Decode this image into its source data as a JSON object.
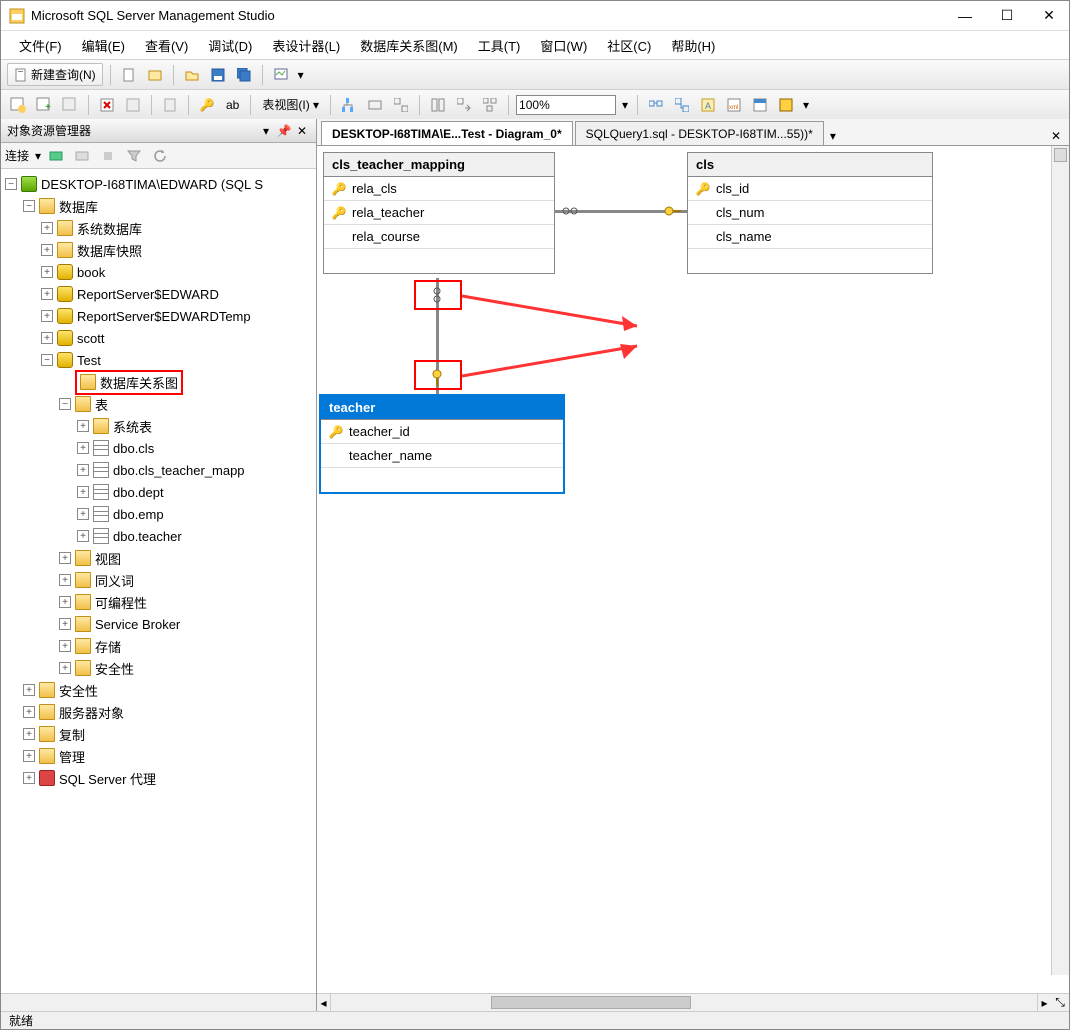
{
  "app": {
    "title": "Microsoft SQL Server Management Studio"
  },
  "menu": {
    "file": "文件(F)",
    "edit": "编辑(E)",
    "view": "查看(V)",
    "debug": "调试(D)",
    "tableDesigner": "表设计器(L)",
    "dbDiagram": "数据库关系图(M)",
    "tools": "工具(T)",
    "window": "窗口(W)",
    "community": "社区(C)",
    "help": "帮助(H)"
  },
  "toolbar1": {
    "newQuery": "新建查询(N)"
  },
  "toolbar2": {
    "ab": "ab",
    "tableView": "表视图(I)",
    "zoom": "100%"
  },
  "objectExplorer": {
    "title": "对象资源管理器",
    "connect": "连接",
    "serverLabel": "DESKTOP-I68TIMA\\EDWARD (SQL S",
    "databases": "数据库",
    "systemDatabases": "系统数据库",
    "dbSnapshots": "数据库快照",
    "book": "book",
    "reportServer": "ReportServer$EDWARD",
    "reportServerTemp": "ReportServer$EDWARDTemp",
    "scott": "scott",
    "test": "Test",
    "dbDiagrams": "数据库关系图",
    "tables": "表",
    "systemTables": "系统表",
    "dboCls": "dbo.cls",
    "dboClsTeacherMapping": "dbo.cls_teacher_mapp",
    "dboDept": "dbo.dept",
    "dboEmp": "dbo.emp",
    "dboTeacher": "dbo.teacher",
    "views": "视图",
    "synonyms": "同义词",
    "programmability": "可编程性",
    "serviceBroker": "Service Broker",
    "storage": "存储",
    "securityInner": "安全性",
    "security": "安全性",
    "serverObjects": "服务器对象",
    "replication": "复制",
    "management": "管理",
    "sqlAgent": "SQL Server 代理"
  },
  "tabs": {
    "tab1": "DESKTOP-I68TIMA\\E...Test - Diagram_0*",
    "tab2": "SQLQuery1.sql - DESKTOP-I68TIM...55))*"
  },
  "diagram": {
    "table1": {
      "name": "cls_teacher_mapping",
      "cols": {
        "c1": "rela_cls",
        "c2": "rela_teacher",
        "c3": "rela_course"
      }
    },
    "table2": {
      "name": "cls",
      "cols": {
        "c1": "cls_id",
        "c2": "cls_num",
        "c3": "cls_name"
      }
    },
    "table3": {
      "name": "teacher",
      "cols": {
        "c1": "teacher_id",
        "c2": "teacher_name"
      }
    }
  },
  "status": {
    "text": "就绪"
  }
}
